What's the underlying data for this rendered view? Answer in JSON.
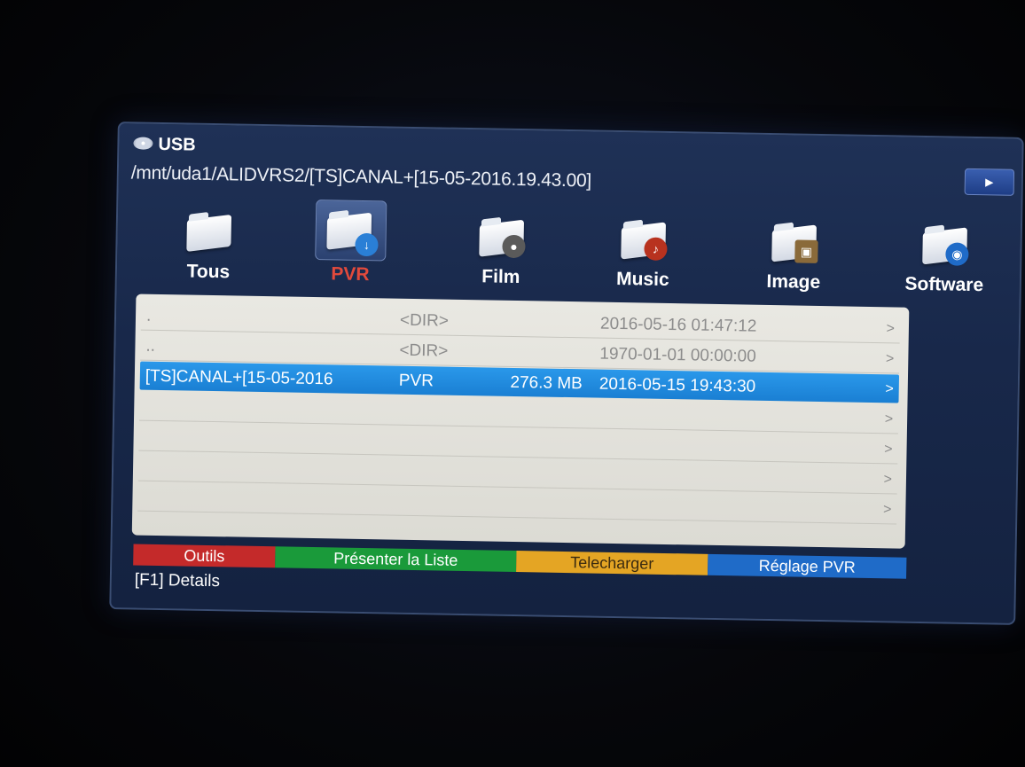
{
  "header": {
    "title": "USB",
    "path": "/mnt/uda1/ALIDVRS2/[TS]CANAL+[15-05-2016.19.43.00]",
    "play_glyph": "▶"
  },
  "categories": [
    {
      "label": "Tous",
      "icon": "folder-icon",
      "active": false
    },
    {
      "label": "PVR",
      "icon": "pvr-download-icon",
      "active": true
    },
    {
      "label": "Film",
      "icon": "film-reel-icon",
      "active": false
    },
    {
      "label": "Music",
      "icon": "music-icon",
      "active": false
    },
    {
      "label": "Image",
      "icon": "image-icon",
      "active": false
    },
    {
      "label": "Software",
      "icon": "software-globe-icon",
      "active": false
    }
  ],
  "files": {
    "rows": [
      {
        "name": ".",
        "type": "<DIR>",
        "size": "",
        "date": "2016-05-16 01:47:12",
        "arrow": ">",
        "selected": false
      },
      {
        "name": "..",
        "type": "<DIR>",
        "size": "",
        "date": "1970-01-01 00:00:00",
        "arrow": ">",
        "selected": false
      },
      {
        "name": "[TS]CANAL+[15-05-2016",
        "type": "PVR",
        "size": "276.3 MB",
        "date": "2016-05-15 19:43:30",
        "arrow": ">",
        "selected": true
      },
      {
        "name": "",
        "type": "",
        "size": "",
        "date": "",
        "arrow": ">",
        "selected": false
      },
      {
        "name": "",
        "type": "",
        "size": "",
        "date": "",
        "arrow": ">",
        "selected": false
      },
      {
        "name": "",
        "type": "",
        "size": "",
        "date": "",
        "arrow": ">",
        "selected": false
      },
      {
        "name": "",
        "type": "",
        "size": "",
        "date": "",
        "arrow": ">",
        "selected": false
      }
    ]
  },
  "buttons": {
    "red": "Outils",
    "green": "Présenter la Liste",
    "yellow": "Telecharger",
    "blue": "Réglage PVR"
  },
  "footer": {
    "details": "[F1]  Details"
  },
  "colors": {
    "panel": "#18284a",
    "list_bg": "#e9e8e2",
    "selection": "#1f8ae0",
    "active_tab": "#e24a3c",
    "red": "#c42a2a",
    "green": "#1a9a3a",
    "yellow": "#e4a524",
    "blue": "#1f6bc8"
  }
}
